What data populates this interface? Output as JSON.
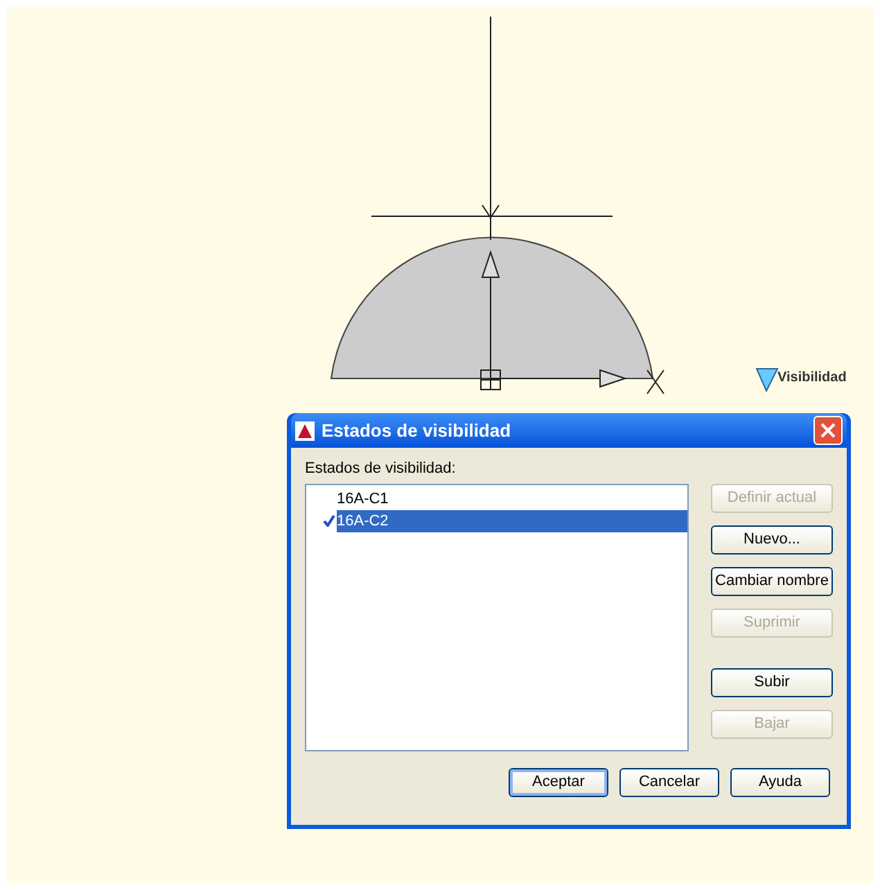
{
  "canvas": {
    "grip_label": "Visibilidad"
  },
  "dialog": {
    "title": "Estados de visibilidad",
    "list_label": "Estados de visibilidad:",
    "states": [
      {
        "text": "16A-C1",
        "selected": false,
        "current": false
      },
      {
        "text": "16A-C2",
        "selected": true,
        "current": true
      }
    ],
    "side_button_groups": [
      [
        {
          "label": "Definir actual",
          "disabled": true
        },
        {
          "label": "Nuevo...",
          "disabled": false
        },
        {
          "label": "Cambiar nombre",
          "disabled": false
        },
        {
          "label": "Suprimir",
          "disabled": true
        }
      ],
      [
        {
          "label": "Subir",
          "disabled": false
        },
        {
          "label": "Bajar",
          "disabled": true
        }
      ]
    ],
    "bottom_buttons": [
      {
        "label": "Aceptar",
        "default": true
      },
      {
        "label": "Cancelar",
        "default": false
      },
      {
        "label": "Ayuda",
        "default": false
      }
    ]
  }
}
